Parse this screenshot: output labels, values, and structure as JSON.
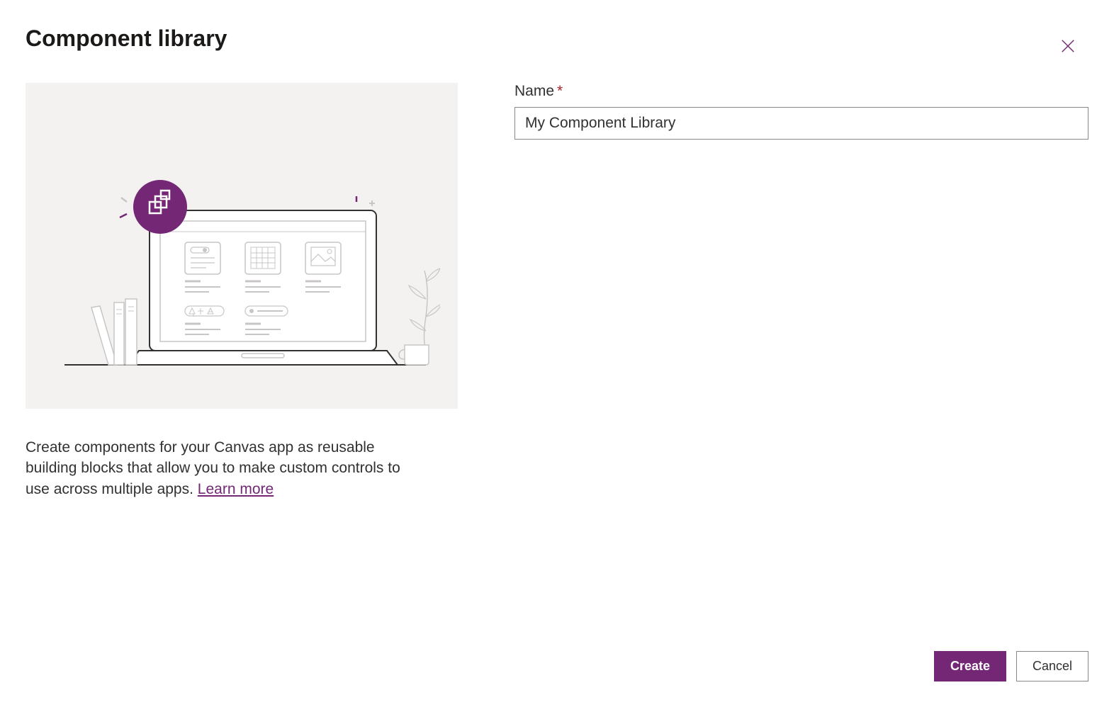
{
  "dialog": {
    "title": "Component library",
    "description": "Create components for your Canvas app as reusable building blocks that allow you to make custom controls to use across multiple apps. ",
    "learn_more_label": "Learn more"
  },
  "form": {
    "name_label": "Name",
    "name_required_marker": "*",
    "name_value": "My Component Library"
  },
  "actions": {
    "create_label": "Create",
    "cancel_label": "Cancel"
  },
  "colors": {
    "accent": "#742774",
    "required": "#a4262c"
  }
}
